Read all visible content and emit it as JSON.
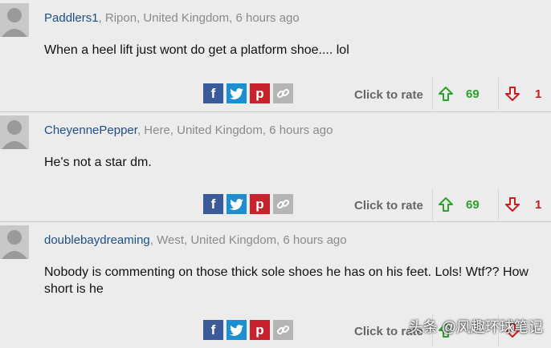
{
  "comments": [
    {
      "user": "Paddlers1",
      "location": ", Ripon, United Kingdom, 6 hours ago",
      "text": "When a heel lift just wont do get a platform shoe.... lol",
      "rate_label": "Click to rate",
      "up": "69",
      "down": "1"
    },
    {
      "user": "CheyennePepper",
      "location": ", Here, United Kingdom, 6 hours ago",
      "text": "He's not a star dm.",
      "rate_label": "Click to rate",
      "up": "69",
      "down": "1"
    },
    {
      "user": "doublebaydreaming",
      "location": ", West, United Kingdom, 6 hours ago",
      "text": "Nobody is commenting on those thick sole shoes he has on his feet. Lols! Wtf?? How short is he",
      "rate_label": "Click to rate",
      "up": "",
      "down": ""
    }
  ],
  "share": {
    "facebook": "f",
    "twitter": "twitter-bird-icon",
    "pinterest": "p",
    "link": "link-icon"
  },
  "colors": {
    "up": "#29a329",
    "down": "#cc1c1c",
    "username": "#1d4f8b",
    "facebook": "#3b5a9a",
    "twitter": "#1c8fd0",
    "pinterest": "#c8232c"
  },
  "watermark": "头条 @风趣环球笔记"
}
